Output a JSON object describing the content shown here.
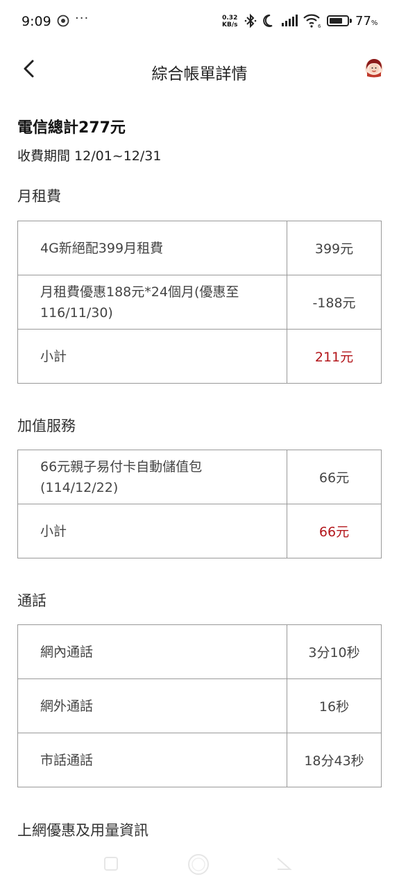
{
  "status_bar": {
    "time": "9:09",
    "speed_value": "0.32",
    "speed_unit": "KB/s",
    "battery": "77",
    "battery_unit": "%",
    "battery_level": 0.77
  },
  "header": {
    "title": "綜合帳單詳情"
  },
  "summary": {
    "total": "電信總計277元",
    "period": "收費期間 12/01~12/31"
  },
  "sections": {
    "monthly": {
      "title": "月租費",
      "rows": [
        {
          "name": "4G新絕配399月租費",
          "value": "399元"
        },
        {
          "name": "月租費優惠188元*24個月(優惠至116/11/30)",
          "value": "-188元"
        },
        {
          "name": "小計",
          "value": "211元"
        }
      ]
    },
    "addon": {
      "title": "加值服務",
      "rows": [
        {
          "name": "66元親子易付卡自動儲值包(114/12/22)",
          "value": "66元"
        },
        {
          "name": "小計",
          "value": "66元"
        }
      ]
    },
    "calls": {
      "title": "通話",
      "rows": [
        {
          "name": "網內通話",
          "value": "3分10秒"
        },
        {
          "name": "網外通話",
          "value": "16秒"
        },
        {
          "name": "市話通話",
          "value": "18分43秒"
        }
      ]
    },
    "data": {
      "title": "上網優惠及用量資訊"
    }
  },
  "colors": {
    "subtotal": "#b3161b",
    "border": "#999999"
  }
}
